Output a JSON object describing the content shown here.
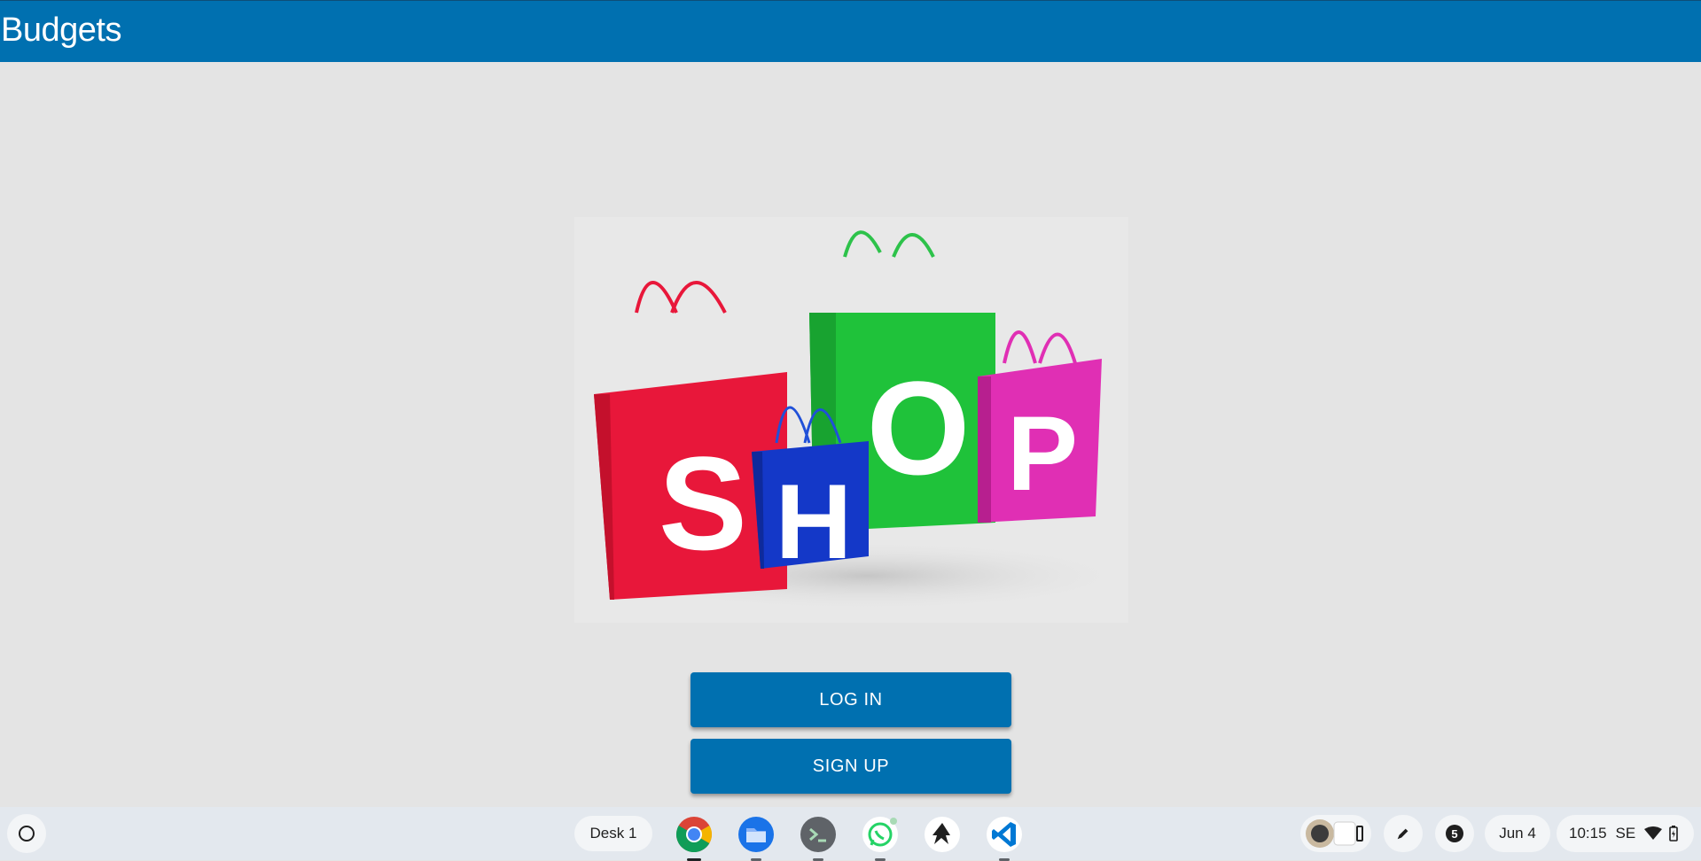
{
  "app": {
    "title": "Budgets"
  },
  "hero": {
    "bag_letters": [
      "S",
      "H",
      "O",
      "P"
    ],
    "bag_colors": [
      "#e8173a",
      "#1438c8",
      "#1fc23a",
      "#e02fb4"
    ]
  },
  "actions": {
    "login_label": "LOG IN",
    "signup_label": "SIGN UP"
  },
  "shelf": {
    "desk_label": "Desk 1",
    "apps": [
      {
        "name": "chrome-icon",
        "running": true
      },
      {
        "name": "files-icon",
        "running": true
      },
      {
        "name": "terminal-icon",
        "running": true
      },
      {
        "name": "whatsapp-icon",
        "running": true
      },
      {
        "name": "inkscape-icon",
        "running": false
      },
      {
        "name": "vscode-icon",
        "running": true
      }
    ],
    "notification_count": "5",
    "date": "Jun 4",
    "time": "10:15",
    "locale": "SE"
  },
  "colors": {
    "primary": "#0070b0",
    "background": "#e4e4e4",
    "shelf": "#e3e8ee"
  }
}
